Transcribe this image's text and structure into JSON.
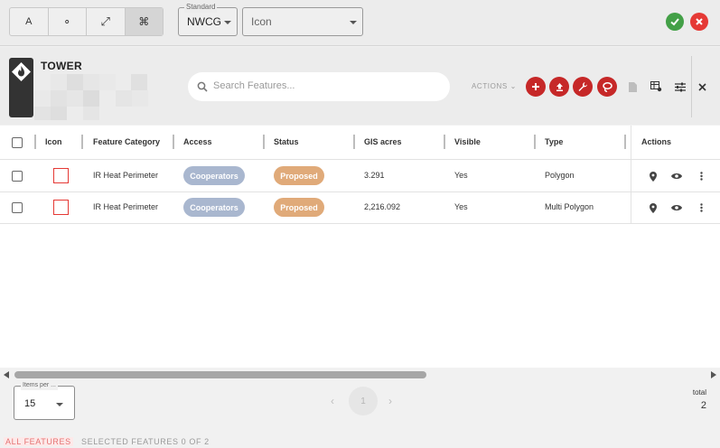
{
  "toolbar": {
    "modes": [
      {
        "label": "A",
        "icon": "text-icon"
      },
      {
        "label": "∘",
        "icon": "point-icon"
      },
      {
        "label": "⤢",
        "icon": "line-icon"
      },
      {
        "label": "⌘",
        "icon": "polygon-icon"
      }
    ],
    "standard": {
      "label": "Standard",
      "value": "NWCG"
    },
    "icon_select": {
      "value": "Icon"
    },
    "confirm_color": "#43a047",
    "cancel_color": "#e53935"
  },
  "header": {
    "title": "TOWER",
    "search_placeholder": "Search Features...",
    "actions_label": "ACTIONS",
    "action_icons": [
      "add-icon",
      "upload-icon",
      "wrench-icon",
      "lasso-icon"
    ],
    "tool_icons": [
      "file-icon",
      "table-settings-icon",
      "tune-icon",
      "close-icon"
    ],
    "accent_color": "#c62828"
  },
  "table": {
    "columns": [
      "Icon",
      "Feature Category",
      "Access",
      "Status",
      "GIS acres",
      "Visible",
      "Type",
      "Actions"
    ],
    "rows": [
      {
        "category": "IR Heat Perimeter",
        "access": "Cooperators",
        "status": "Proposed",
        "acres": "3.291",
        "visible": "Yes",
        "type": "Polygon"
      },
      {
        "category": "IR Heat Perimeter",
        "access": "Cooperators",
        "status": "Proposed",
        "acres": "2,216.092",
        "visible": "Yes",
        "type": "Multi Polygon"
      }
    ],
    "access_color": "#a9b7cf",
    "status_color": "#e0aa79"
  },
  "footer": {
    "items_per_page_label": "Items per ...",
    "items_per_page": "15",
    "page": "1",
    "total_label": "total",
    "total": "2",
    "tab_all": "ALL FEATURES",
    "tab_selected": "SELECTED FEATURES 0 OF 2"
  }
}
